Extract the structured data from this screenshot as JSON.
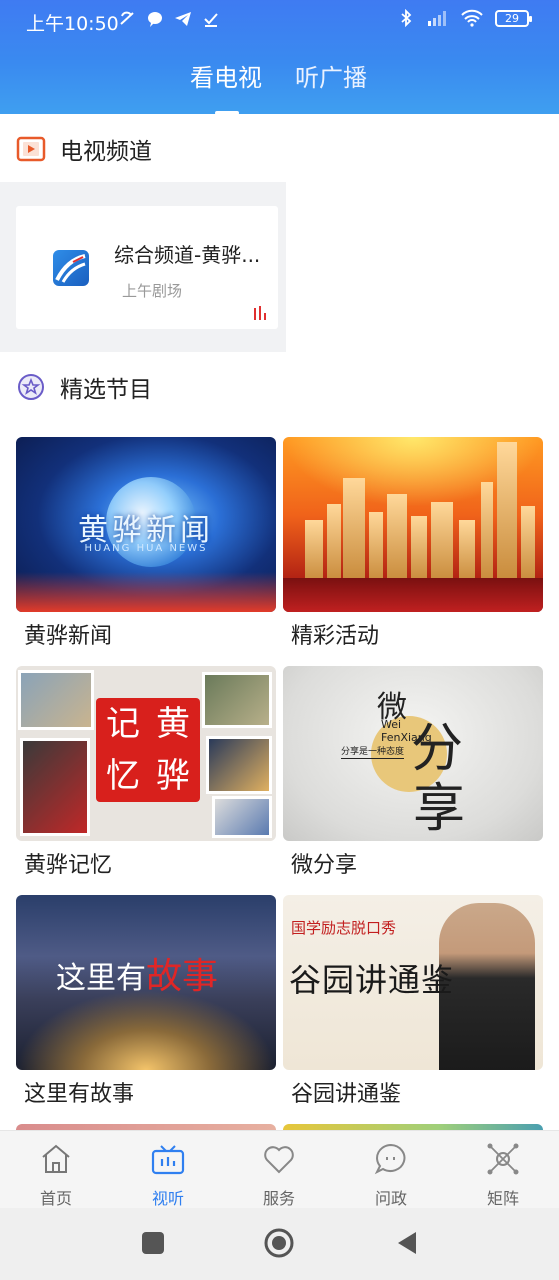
{
  "status_bar": {
    "time": "上午10:50",
    "battery": "29"
  },
  "top_tabs": [
    {
      "label": "看电视"
    },
    {
      "label": "听广播"
    }
  ],
  "colors": {
    "primary": "#2f7ff0",
    "header_gradient_top": "#3f7bf2",
    "live_red": "#e03030"
  },
  "tv_section": {
    "title": "电视频道",
    "channel": {
      "name": "综合频道-黄骅...",
      "program": "上午剧场"
    }
  },
  "featured_section": {
    "title": "精选节目",
    "programs": [
      {
        "label": "黄骅新闻",
        "thumb_text": "黄骅新闻",
        "thumb_sub": "HUANG HUA NEWS"
      },
      {
        "label": "精彩活动"
      },
      {
        "label": "黄骅记忆",
        "thumb_seal": [
          "记",
          "黄",
          "忆",
          "骅"
        ]
      },
      {
        "label": "微分享",
        "thumb_parts": [
          "微",
          "分",
          "享"
        ],
        "thumb_en": [
          "Wei",
          "FenXiang"
        ],
        "thumb_slogan": "分享是一种态度"
      },
      {
        "label": "这里有故事",
        "thumb_text_a": "这里有",
        "thumb_text_b": "故事"
      },
      {
        "label": "谷园讲通鉴",
        "thumb_top": "国学励志脱口秀",
        "thumb_brush": "谷园讲通鉴"
      }
    ]
  },
  "bottom_nav": {
    "items": [
      {
        "label": "首页",
        "icon": "home-icon"
      },
      {
        "label": "视听",
        "icon": "tv-icon",
        "active": true
      },
      {
        "label": "服务",
        "icon": "heart-icon"
      },
      {
        "label": "问政",
        "icon": "chat-icon"
      },
      {
        "label": "矩阵",
        "icon": "matrix-icon"
      }
    ]
  }
}
